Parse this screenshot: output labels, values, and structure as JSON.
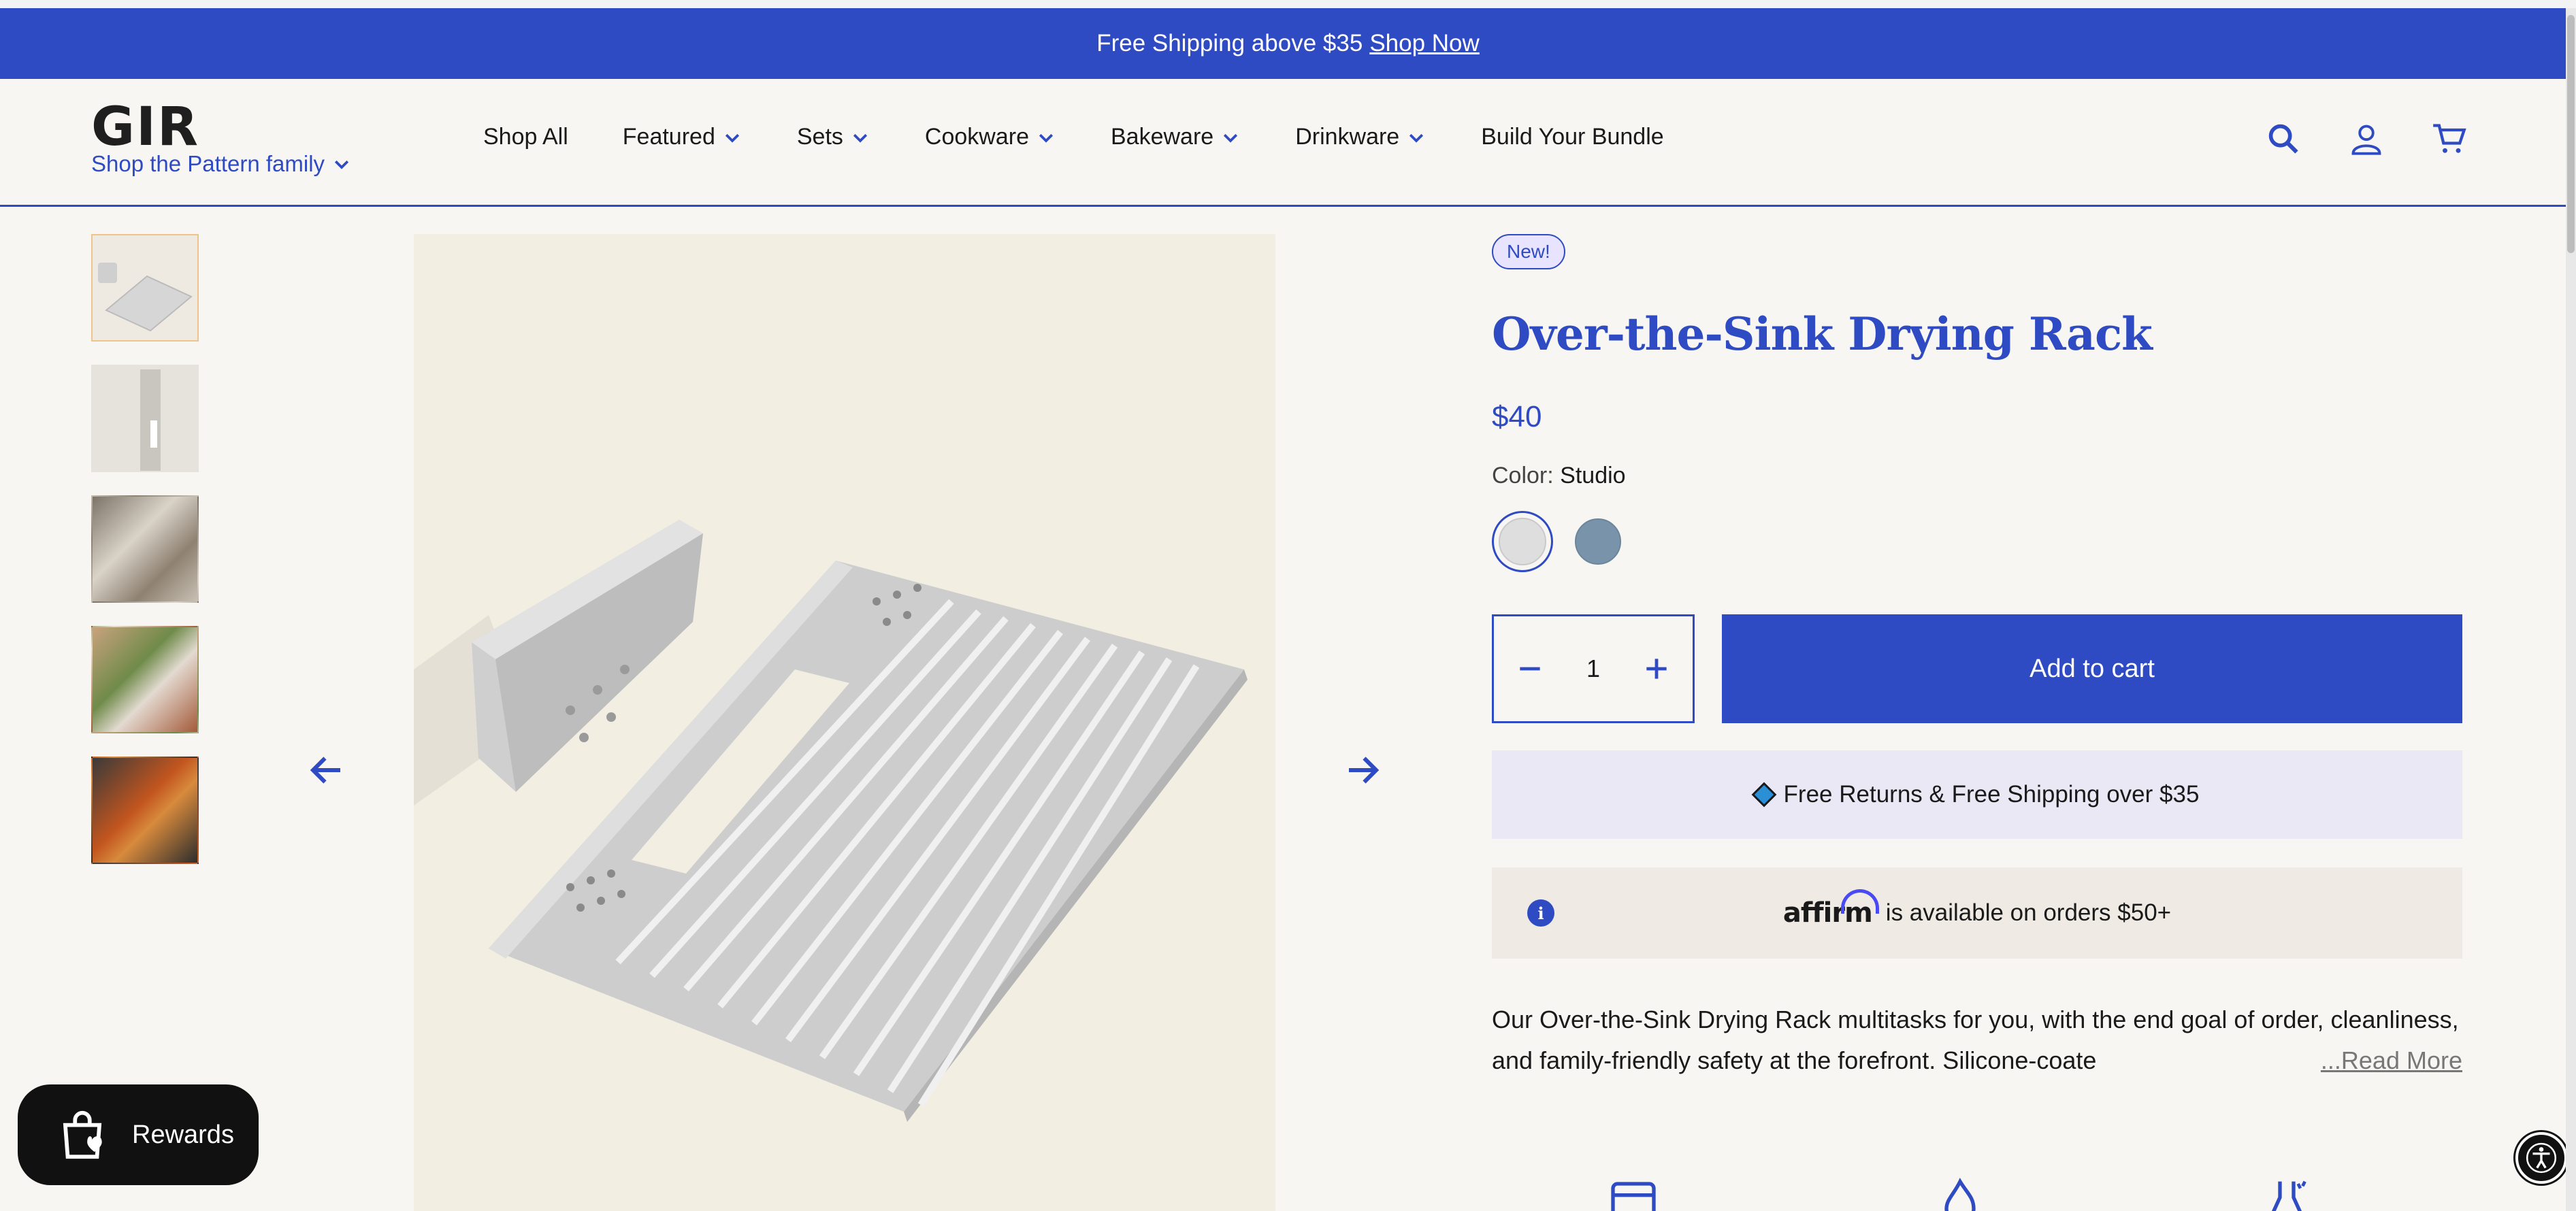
{
  "promo": {
    "text": "Free Shipping above $35",
    "link": "Shop Now"
  },
  "header": {
    "logo": "GIR",
    "family_label": "Shop the Pattern family",
    "nav": [
      {
        "label": "Shop All",
        "dropdown": false
      },
      {
        "label": "Featured",
        "dropdown": true
      },
      {
        "label": "Sets",
        "dropdown": true
      },
      {
        "label": "Cookware",
        "dropdown": true
      },
      {
        "label": "Bakeware",
        "dropdown": true
      },
      {
        "label": "Drinkware",
        "dropdown": true
      },
      {
        "label": "Build Your Bundle",
        "dropdown": false
      }
    ],
    "icons": [
      "search-icon",
      "account-icon",
      "cart-icon"
    ]
  },
  "gallery": {
    "thumbnail_count": 5,
    "active_index": 0
  },
  "product": {
    "badge": "New!",
    "title": "Over-the-Sink Drying Rack",
    "price": "$40",
    "color_label": "Color:",
    "color_value": "Studio",
    "swatches": [
      {
        "name": "Studio",
        "color": "#dedede",
        "selected": true
      },
      {
        "name": "Slate",
        "color": "#7893aa",
        "selected": false
      }
    ],
    "quantity": "1",
    "add_to_cart": "Add to cart",
    "shipping_note": "Free Returns & Free Shipping over $35",
    "affirm_logo": "affirm",
    "affirm_text": "is available on orders $50+",
    "description": "Our Over-the-Sink Drying Rack multitasks for you, with the end goal of order, cleanliness, and family-friendly safety at the forefront. Silicone-coate",
    "read_more": "...Read More"
  },
  "rewards": {
    "label": "Rewards"
  },
  "colors": {
    "brand": "#2f4bc3",
    "badge_bg": "#e8e4ff",
    "shipping_bg": "#ebe8f6",
    "affirm_bg": "#efeae3"
  }
}
